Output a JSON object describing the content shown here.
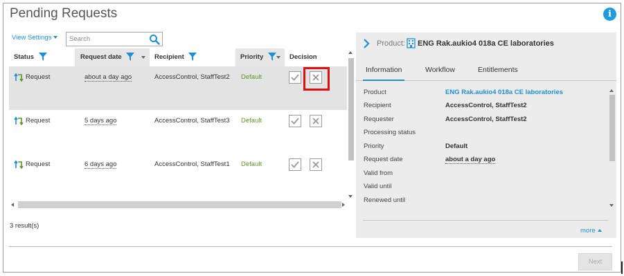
{
  "page": {
    "title": "Pending Requests"
  },
  "toolbar": {
    "view_settings_label": "View Settings",
    "search_placeholder": "Search",
    "search_value": ""
  },
  "table": {
    "columns": [
      "Status",
      "Request date",
      "Recipient",
      "Priority",
      "Decision"
    ],
    "rows": [
      {
        "status": "Request",
        "request_date": "about a day ago",
        "recipient": "AccessControl, StaffTest2",
        "priority": "Default"
      },
      {
        "status": "Request",
        "request_date": "5 days ago",
        "recipient": "AccessControl, StaffTest3",
        "priority": "Default"
      },
      {
        "status": "Request",
        "request_date": "6 days ago",
        "recipient": "AccessControl, StaffTest1",
        "priority": "Default"
      }
    ]
  },
  "footer": {
    "results_label": "3 result(s)",
    "next_label": "Next"
  },
  "panel": {
    "product_label": "Product:",
    "product_name": "ENG Rak.aukio4 018a CE laboratories",
    "tabs": [
      "Information",
      "Workflow",
      "Entitlements"
    ],
    "details": [
      {
        "label": "Product",
        "value": "ENG Rak.aukio4 018a CE laboratories"
      },
      {
        "label": "Recipient",
        "value": "AccessControl, StaffTest2"
      },
      {
        "label": "Requester",
        "value": "AccessControl, StaffTest2"
      },
      {
        "label": "Processing status",
        "value": ""
      },
      {
        "label": "Priority",
        "value": "Default"
      },
      {
        "label": "Request date",
        "value": "about a day ago"
      },
      {
        "label": "Valid from",
        "value": ""
      },
      {
        "label": "Valid until",
        "value": ""
      },
      {
        "label": "Renewed until",
        "value": ""
      }
    ],
    "more_label": "more"
  },
  "colors": {
    "accent": "#1e8fd6",
    "priority": "#5a9a2a",
    "highlight": "#e01010",
    "selected_row": "#e3e3e3",
    "panel_bg": "#ececec"
  },
  "icons": {
    "info": "info-icon",
    "search": "search-icon",
    "filter": "filter-icon",
    "status": "request-arrows-icon",
    "approve": "check-icon",
    "reject": "x-icon",
    "expand": "chevron-right-icon",
    "product": "building-icon"
  }
}
